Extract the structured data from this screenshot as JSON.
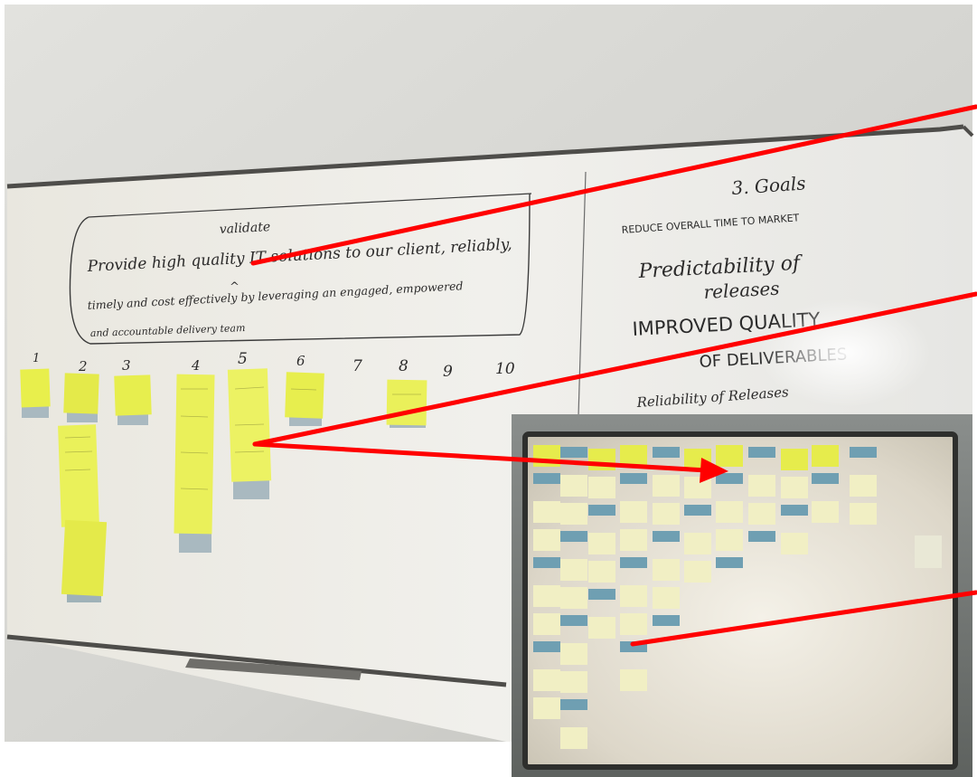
{
  "photo": "whiteboard with sticky notes",
  "whiteboard_left": {
    "mission_heading": "validate",
    "mission_line1": "Provide high quality IT solutions to our client, reliably,",
    "mission_insert": "^",
    "mission_line2": "timely and cost effectively by leveraging an engaged, empowered",
    "mission_line3": "and accountable delivery team",
    "column_numbers": [
      "1",
      "2",
      "3",
      "4",
      "5",
      "6",
      "7",
      "8",
      "9",
      "10"
    ]
  },
  "whiteboard_right": {
    "heading": "3. Goals",
    "goal1": "REDUCE OVERALL TIME TO MARKET",
    "goal2_line1": "Predictability of",
    "goal2_line2": "releases",
    "goal3_line1": "IMPROVED QUALITY",
    "goal3_line2": "OF DELIVERABLES",
    "goal4": "Reliability of Releases"
  },
  "colors": {
    "arrow": "#ff0000",
    "sticky_yellow": "#e8ee4a",
    "sticky_blue": "#8ab6c8",
    "board_white": "#f2f2ee",
    "wall": "#d8d8d4"
  }
}
